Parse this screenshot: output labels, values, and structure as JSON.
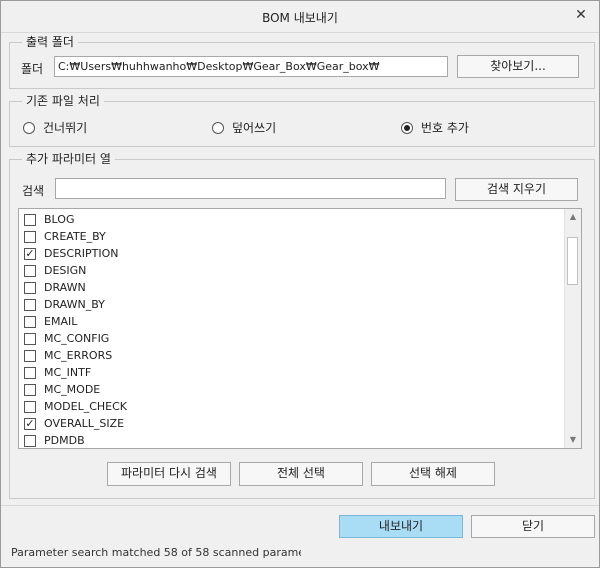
{
  "window": {
    "title": "BOM 내보내기"
  },
  "output_folder": {
    "legend": "출력 폴더",
    "label": "폴더",
    "path": "C:₩Users₩huhhwanho₩Desktop₩Gear_Box₩Gear_box₩",
    "browse_label": "찾아보기..."
  },
  "existing_file": {
    "legend": "기존 파일 처리",
    "options": [
      {
        "label": "건너뛰기",
        "selected": false
      },
      {
        "label": "덮어쓰기",
        "selected": false
      },
      {
        "label": "번호 추가",
        "selected": true
      }
    ]
  },
  "params": {
    "legend": "추가 파라미터 열",
    "search_label": "검색",
    "search_value": "",
    "clear_search_label": "검색 지우기",
    "items": [
      {
        "name": "BLOG",
        "checked": false
      },
      {
        "name": "CREATE_BY",
        "checked": false
      },
      {
        "name": "DESCRIPTION",
        "checked": true
      },
      {
        "name": "DESIGN",
        "checked": false
      },
      {
        "name": "DRAWN",
        "checked": false
      },
      {
        "name": "DRAWN_BY",
        "checked": false
      },
      {
        "name": "EMAIL",
        "checked": false
      },
      {
        "name": "MC_CONFIG",
        "checked": false
      },
      {
        "name": "MC_ERRORS",
        "checked": false
      },
      {
        "name": "MC_INTF",
        "checked": false
      },
      {
        "name": "MC_MODE",
        "checked": false
      },
      {
        "name": "MODEL_CHECK",
        "checked": false
      },
      {
        "name": "OVERALL_SIZE",
        "checked": true
      },
      {
        "name": "PDMDB",
        "checked": false
      }
    ],
    "rescan_label": "파라미터 다시 검색",
    "select_all_label": "전체 선택",
    "deselect_label": "선택 해제"
  },
  "footer": {
    "export_label": "내보내기",
    "close_label": "닫기",
    "status": "Parameter search matched 58 of 58 scanned paramet"
  }
}
